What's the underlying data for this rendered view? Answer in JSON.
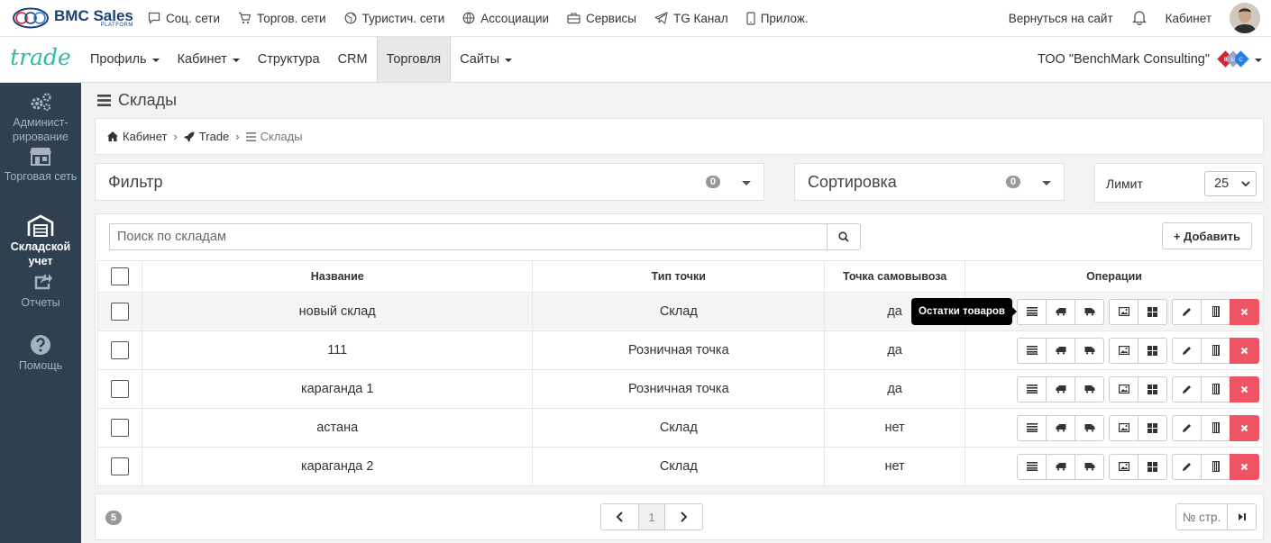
{
  "topbar": {
    "brand_name": "BMC Sales",
    "brand_sub": "PLATFORM",
    "links": [
      {
        "label": "Соц. сети",
        "icon": "chat-icon"
      },
      {
        "label": "Торгов. сети",
        "icon": "cart-icon"
      },
      {
        "label": "Туристич. сети",
        "icon": "globe-icon"
      },
      {
        "label": "Ассоциации",
        "icon": "network-icon"
      },
      {
        "label": "Сервисы",
        "icon": "briefcase-icon"
      },
      {
        "label": "TG Канал",
        "icon": "telegram-icon"
      },
      {
        "label": "Прилож.",
        "icon": "mobile-icon"
      }
    ],
    "back_to_site": "Вернуться на сайт",
    "cabinet": "Кабинет"
  },
  "nav": {
    "logo": "trade",
    "items": [
      {
        "label": "Профиль",
        "dropdown": true
      },
      {
        "label": "Кабинет",
        "dropdown": true
      },
      {
        "label": "Структура",
        "dropdown": false
      },
      {
        "label": "CRM",
        "dropdown": false
      },
      {
        "label": "Торговля",
        "dropdown": false,
        "active": true
      },
      {
        "label": "Сайты",
        "dropdown": true
      }
    ],
    "company": "ТОО \"BenchMark Consulting\"",
    "badge_letters": [
      "B",
      "M",
      "C"
    ]
  },
  "sidebar": {
    "items": [
      {
        "label": "Админист-рирование",
        "icon": "gears-icon"
      },
      {
        "label": "Торговая сеть",
        "icon": "store-icon"
      },
      {
        "label": "Складской учет",
        "icon": "warehouse-icon",
        "active": true
      },
      {
        "label": "Отчеты",
        "icon": "share-icon"
      },
      {
        "label": "Помощь",
        "icon": "question-icon"
      }
    ]
  },
  "page": {
    "title": "Склады",
    "breadcrumb": [
      "Кабинет",
      "Trade",
      "Склады"
    ]
  },
  "filter": {
    "label": "Фильтр",
    "count": "0"
  },
  "sort": {
    "label": "Сортировка",
    "count": "0"
  },
  "limit": {
    "label": "Лимит",
    "value": "25"
  },
  "search": {
    "placeholder": "Поиск по складам"
  },
  "add_button": "+ Добавить",
  "table": {
    "columns": [
      "Название",
      "Тип точки",
      "Точка самовывоза",
      "Операции"
    ],
    "rows": [
      {
        "name": "новый склад",
        "type": "Склад",
        "pickup": "да"
      },
      {
        "name": "111",
        "type": "Розничная точка",
        "pickup": "да"
      },
      {
        "name": "караганда 1",
        "type": "Розничная точка",
        "pickup": "да"
      },
      {
        "name": "астана",
        "type": "Склад",
        "pickup": "нет"
      },
      {
        "name": "караганда 2",
        "type": "Склад",
        "pickup": "нет"
      }
    ]
  },
  "tooltip": "Остатки товаров",
  "pager": {
    "total": "5",
    "page": "1",
    "goto_placeholder": "№ стр."
  },
  "colors": {
    "sidebar": "#2f4050",
    "accent": "#2fb9a0",
    "danger": "#ed5565",
    "brand": "#1b3f7a"
  }
}
